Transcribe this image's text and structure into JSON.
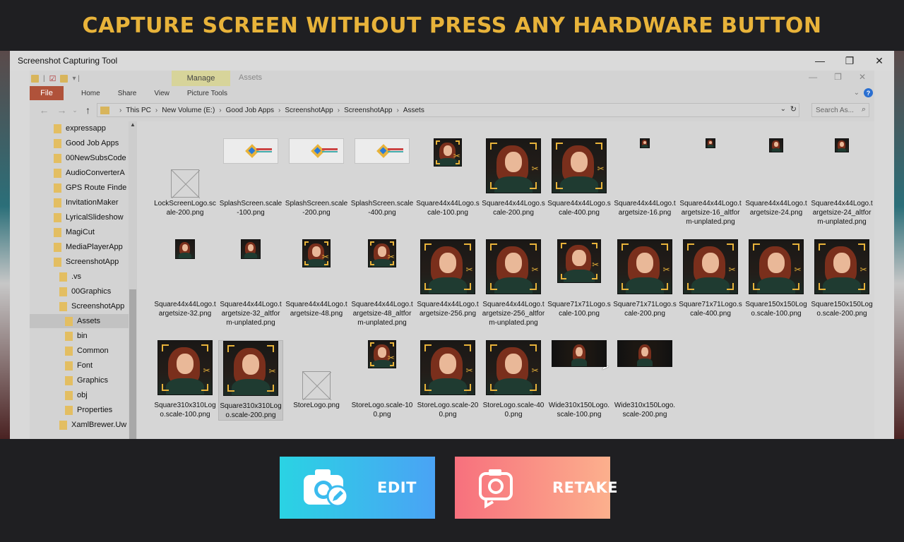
{
  "headline": "CAPTURE SCREEN WITHOUT PRESS ANY HARDWARE BUTTON",
  "window": {
    "title": "Screenshot Capturing Tool",
    "controls": [
      "—",
      "❐",
      "✕"
    ]
  },
  "explorer": {
    "context_tab": "Manage",
    "context_title": "Assets",
    "ribbon_tabs": [
      "File",
      "Home",
      "Share",
      "View",
      "Picture Tools"
    ],
    "breadcrumb": [
      "This PC",
      "New Volume (E:)",
      "Good Job Apps",
      "ScreenshotApp",
      "ScreenshotApp",
      "Assets"
    ],
    "search_placeholder": "Search As...",
    "tree": [
      {
        "label": "expressapp",
        "indent": 0,
        "selected": false
      },
      {
        "label": "Good Job Apps",
        "indent": 0,
        "selected": false
      },
      {
        "label": "00NewSubsCode",
        "indent": 1,
        "selected": false
      },
      {
        "label": "AudioConverterA",
        "indent": 1,
        "selected": false
      },
      {
        "label": "GPS Route Finde",
        "indent": 1,
        "selected": false
      },
      {
        "label": "InvitationMaker",
        "indent": 1,
        "selected": false
      },
      {
        "label": "LyricalSlideshow",
        "indent": 1,
        "selected": false
      },
      {
        "label": "MagiCut",
        "indent": 1,
        "selected": false
      },
      {
        "label": "MediaPlayerApp",
        "indent": 1,
        "selected": false
      },
      {
        "label": "ScreenshotApp",
        "indent": 1,
        "selected": false
      },
      {
        "label": ".vs",
        "indent": 2,
        "selected": false
      },
      {
        "label": "00Graphics",
        "indent": 2,
        "selected": false
      },
      {
        "label": "ScreenshotApp",
        "indent": 2,
        "selected": false
      },
      {
        "label": "Assets",
        "indent": 3,
        "selected": true
      },
      {
        "label": "bin",
        "indent": 3,
        "selected": false
      },
      {
        "label": "Common",
        "indent": 3,
        "selected": false
      },
      {
        "label": "Font",
        "indent": 3,
        "selected": false
      },
      {
        "label": "Graphics",
        "indent": 3,
        "selected": false
      },
      {
        "label": "obj",
        "indent": 3,
        "selected": false
      },
      {
        "label": "Properties",
        "indent": 3,
        "selected": false
      },
      {
        "label": "XamlBrewer.Uw",
        "indent": 2,
        "selected": false
      }
    ],
    "files": [
      {
        "name": "LockScreenLogo.scale-200.png",
        "thumb": "placeholder",
        "selected": false
      },
      {
        "name": "SplashScreen.scale-100.png",
        "thumb": "splash",
        "selected": false
      },
      {
        "name": "SplashScreen.scale-200.png",
        "thumb": "splash",
        "selected": false
      },
      {
        "name": "SplashScreen.scale-400.png",
        "thumb": "splash",
        "selected": false
      },
      {
        "name": "Square44x44Logo.scale-100.png",
        "thumb": "portrait-s",
        "selected": false
      },
      {
        "name": "Square44x44Logo.scale-200.png",
        "thumb": "portrait-l",
        "selected": false
      },
      {
        "name": "Square44x44Logo.scale-400.png",
        "thumb": "portrait-l",
        "selected": false
      },
      {
        "name": "Square44x44Logo.targetsize-16.png",
        "thumb": "portrait-xs",
        "selected": false
      },
      {
        "name": "Square44x44Logo.targetsize-16_altform-unplated.png",
        "thumb": "portrait-xs",
        "selected": false
      },
      {
        "name": "Square44x44Logo.targetsize-24.png",
        "thumb": "portrait-xxs",
        "selected": false
      },
      {
        "name": "Square44x44Logo.targetsize-24_altform-unplated.png",
        "thumb": "portrait-xxs",
        "selected": false
      },
      {
        "name": "Square44x44Logo.targetsize-32.png",
        "thumb": "portrait-ss",
        "selected": false
      },
      {
        "name": "Square44x44Logo.targetsize-32_altform-unplated.png",
        "thumb": "portrait-ss",
        "selected": false
      },
      {
        "name": "Square44x44Logo.targetsize-48.png",
        "thumb": "portrait-s",
        "selected": false
      },
      {
        "name": "Square44x44Logo.targetsize-48_altform-unplated.png",
        "thumb": "portrait-s",
        "selected": false
      },
      {
        "name": "Square44x44Logo.targetsize-256.png",
        "thumb": "portrait-l",
        "selected": false
      },
      {
        "name": "Square44x44Logo.targetsize-256_altform-unplated.png",
        "thumb": "portrait-l",
        "selected": false
      },
      {
        "name": "Square71x71Logo.scale-100.png",
        "thumb": "portrait-m",
        "selected": false
      },
      {
        "name": "Square71x71Logo.scale-200.png",
        "thumb": "portrait-l",
        "selected": false
      },
      {
        "name": "Square71x71Logo.scale-400.png",
        "thumb": "portrait-l",
        "selected": false
      },
      {
        "name": "Square150x150Logo.scale-100.png",
        "thumb": "portrait-l",
        "selected": false
      },
      {
        "name": "Square150x150Logo.scale-200.png",
        "thumb": "portrait-l",
        "selected": false
      },
      {
        "name": "Square310x310Logo.scale-100.png",
        "thumb": "portrait-l",
        "selected": false
      },
      {
        "name": "Square310x310Logo.scale-200.png",
        "thumb": "portrait-l",
        "selected": true
      },
      {
        "name": "StoreLogo.png",
        "thumb": "placeholder",
        "selected": false
      },
      {
        "name": "StoreLogo.scale-100.png",
        "thumb": "portrait-s",
        "selected": false
      },
      {
        "name": "StoreLogo.scale-200.png",
        "thumb": "portrait-l",
        "selected": false
      },
      {
        "name": "StoreLogo.scale-400.png",
        "thumb": "portrait-l",
        "selected": false
      },
      {
        "name": "Wide310x150Logo.scale-100.png",
        "thumb": "wide",
        "selected": false
      },
      {
        "name": "Wide310x150Logo.scale-200.png",
        "thumb": "wide",
        "selected": false
      }
    ]
  },
  "actions": {
    "edit_label": "EDIT",
    "retake_label": "RETAKE",
    "edit_icon": "camera-edit-icon",
    "retake_icon": "retake-icon"
  },
  "colors": {
    "headline": "#e8b33a",
    "background": "#1f1f22",
    "file_tab": "#b0523a",
    "manage_tab": "#d7d49a"
  }
}
